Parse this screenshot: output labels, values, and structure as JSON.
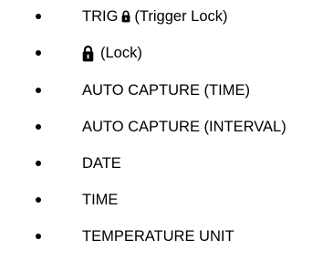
{
  "items": [
    {
      "prefix": "TRIG",
      "icon": "lock-icon",
      "suffix": "(Trigger Lock)"
    },
    {
      "prefix": "",
      "icon": "lock-icon",
      "suffix": "(Lock)"
    },
    {
      "label": "AUTO CAPTURE (TIME)"
    },
    {
      "label": "AUTO CAPTURE (INTERVAL)"
    },
    {
      "label": "DATE"
    },
    {
      "label": "TIME"
    },
    {
      "label": "TEMPERATURE UNIT"
    }
  ]
}
